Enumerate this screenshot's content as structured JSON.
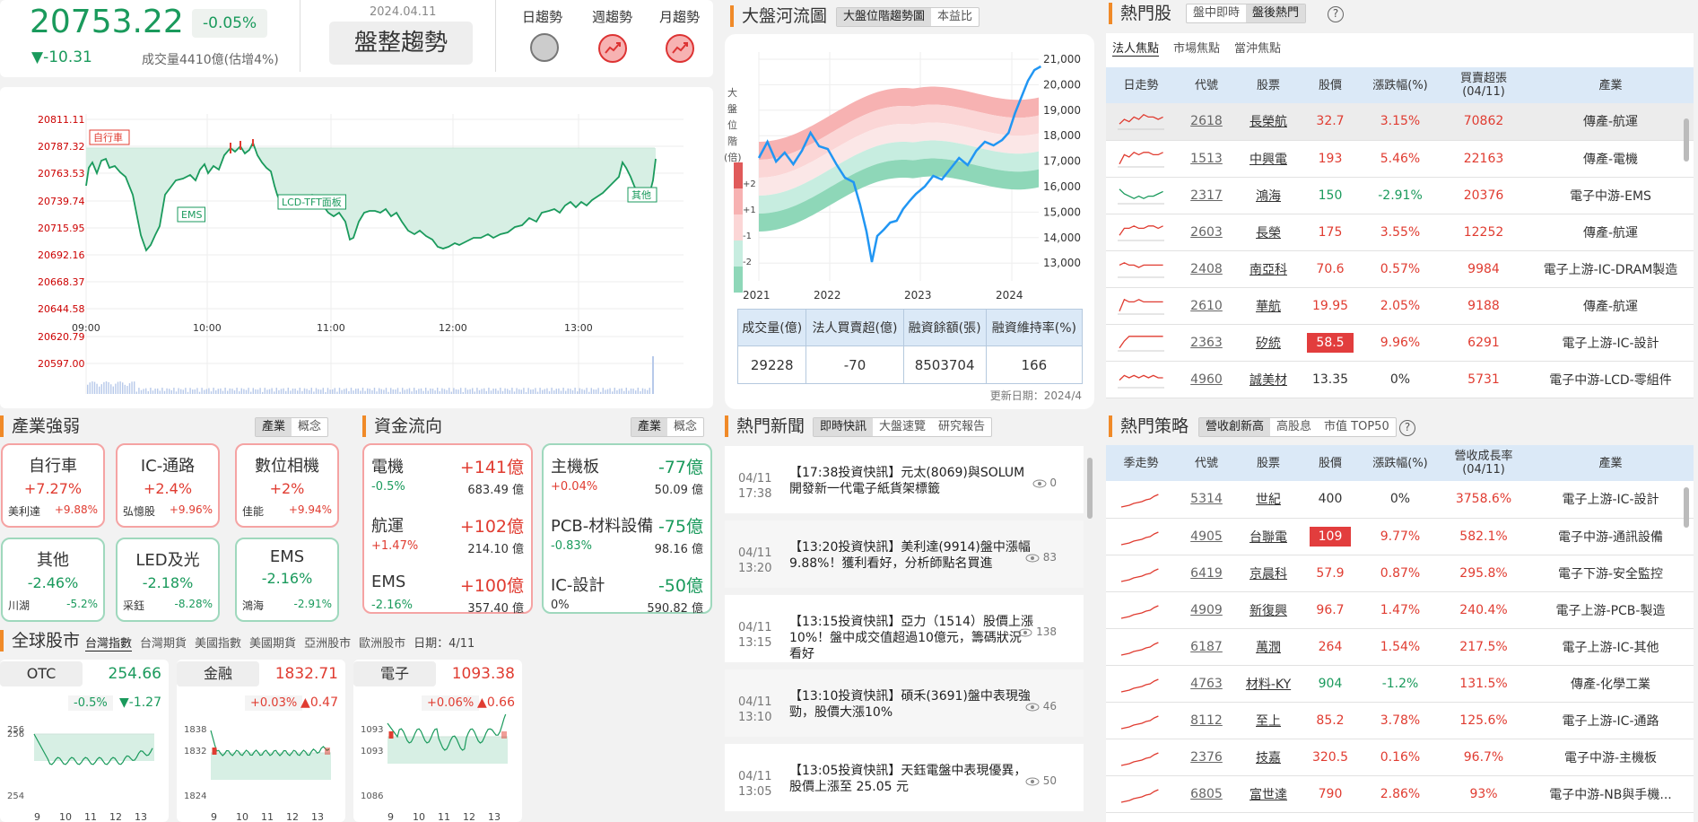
{
  "index": {
    "value": "20753.22",
    "change_pct": "-0.05%",
    "change": "▼-10.31",
    "volume": "成交量4410億(估增4%)",
    "date": "2024.04.11",
    "trend_label": "盤整趨勢",
    "trend_tabs": [
      "日趨勢",
      "週趨勢",
      "月趨勢"
    ]
  },
  "intraday": {
    "y_ticks": [
      "20811.11",
      "20787.32",
      "20763.53",
      "20739.74",
      "20715.95",
      "20692.16",
      "20668.37",
      "20644.58",
      "20620.79",
      "20597.00"
    ],
    "x_ticks": [
      "09:00",
      "10:00",
      "11:00",
      "12:00",
      "13:00"
    ],
    "annotations": [
      "自行車",
      "EMS",
      "LCD-TFT面板",
      "其他"
    ]
  },
  "river": {
    "title": "大盤河流圖",
    "tabs": [
      "大盤位階趨勢圖",
      "本益比"
    ],
    "ylabel_chars": [
      "大",
      "盤",
      "位",
      "階",
      "(倍)"
    ],
    "bands": [
      "+2",
      "+1",
      "-1",
      "-2"
    ],
    "y_ticks": [
      "21,000",
      "20,000",
      "19,000",
      "18,000",
      "17,000",
      "16,000",
      "15,000",
      "14,000",
      "13,000"
    ],
    "x_ticks": [
      "2021",
      "2022",
      "2023",
      "2024"
    ],
    "table_headers": [
      "成交量(億)",
      "法人買賣超(億)",
      "融資餘額(張)",
      "融資維持率(%)"
    ],
    "table_values": [
      "29228",
      "-70",
      "8503704",
      "166"
    ],
    "update": "更新日期：2024/4"
  },
  "hot_stocks": {
    "title": "熱門股",
    "tabs": [
      "盤中即時",
      "盤後熱門"
    ],
    "subtabs": [
      "法人焦點",
      "市場焦點",
      "當沖焦點"
    ],
    "headers": [
      "日走勢",
      "代號",
      "股票",
      "股價",
      "漲跌幅(%)",
      "買賣超張\n(04/11)",
      "產業"
    ],
    "rows": [
      {
        "code": "2618",
        "name": "長榮航",
        "price": "32.7",
        "pct": "3.15%",
        "vol": "70862",
        "ind": "傳產-航運",
        "dir": "up"
      },
      {
        "code": "1513",
        "name": "中興電",
        "price": "193",
        "pct": "5.46%",
        "vol": "22163",
        "ind": "傳產-電機",
        "dir": "up"
      },
      {
        "code": "2317",
        "name": "鴻海",
        "price": "150",
        "pct": "-2.91%",
        "vol": "20376",
        "ind": "電子中游-EMS",
        "dir": "dn"
      },
      {
        "code": "2603",
        "name": "長榮",
        "price": "175",
        "pct": "3.55%",
        "vol": "12252",
        "ind": "傳產-航運",
        "dir": "up"
      },
      {
        "code": "2408",
        "name": "南亞科",
        "price": "70.6",
        "pct": "0.57%",
        "vol": "9984",
        "ind": "電子上游-IC-DRAM製造",
        "dir": "up"
      },
      {
        "code": "2610",
        "name": "華航",
        "price": "19.95",
        "pct": "2.05%",
        "vol": "9188",
        "ind": "傳產-航運",
        "dir": "up"
      },
      {
        "code": "2363",
        "name": "矽統",
        "price": "58.5",
        "pct": "9.96%",
        "vol": "6291",
        "ind": "電子上游-IC-設計",
        "dir": "hl"
      },
      {
        "code": "4960",
        "name": "誠美材",
        "price": "13.35",
        "pct": "0%",
        "vol": "5731",
        "ind": "電子中游-LCD-零組件",
        "dir": "nt"
      }
    ]
  },
  "industry": {
    "title": "產業強弱",
    "tabs": [
      "產業",
      "概念"
    ],
    "boxes": [
      {
        "name": "自行車",
        "pct": "+7.27%",
        "stock": "美利達",
        "spct": "+9.88%",
        "dir": "up"
      },
      {
        "name": "IC-通路",
        "pct": "+2.4%",
        "stock": "弘憶股",
        "spct": "+9.96%",
        "dir": "up"
      },
      {
        "name": "數位相機",
        "pct": "+2%",
        "stock": "佳能",
        "spct": "+9.94%",
        "dir": "up"
      },
      {
        "name": "其他",
        "pct": "-2.46%",
        "stock": "川湖",
        "spct": "-5.2%",
        "dir": "dn"
      },
      {
        "name": "LED及光",
        "pct": "-2.18%",
        "stock": "采鈺",
        "spct": "-8.28%",
        "dir": "dn"
      },
      {
        "name": "EMS",
        "pct": "-2.16%",
        "stock": "鴻海",
        "spct": "-2.91%",
        "dir": "dn"
      }
    ]
  },
  "fund": {
    "title": "資金流向",
    "tabs": [
      "產業",
      "概念"
    ],
    "up": [
      {
        "name": "電機",
        "val": "+141億",
        "pct": "-0.5%",
        "amt": "683.49 億",
        "pdir": "dn"
      },
      {
        "name": "航運",
        "val": "+102億",
        "pct": "+1.47%",
        "amt": "214.10 億",
        "pdir": "up"
      },
      {
        "name": "EMS",
        "val": "+100億",
        "pct": "-2.16%",
        "amt": "357.40 億",
        "pdir": "dn"
      }
    ],
    "down": [
      {
        "name": "主機板",
        "val": "-77億",
        "pct": "+0.04%",
        "amt": "50.09 億",
        "pdir": "up"
      },
      {
        "name": "PCB-材料設備",
        "val": "-75億",
        "pct": "-0.83%",
        "amt": "98.16 億",
        "pdir": "dn"
      },
      {
        "name": "IC-設計",
        "val": "-50億",
        "pct": "0%",
        "amt": "590.82 億",
        "pdir": "nt"
      }
    ]
  },
  "global": {
    "title": "全球股市",
    "tabs": [
      "台灣指數",
      "台灣期貨",
      "美國指數",
      "美國期貨",
      "亞洲股市",
      "歐洲股市"
    ],
    "date": "日期：4/11",
    "cards": [
      {
        "name": "OTC",
        "val": "254.66",
        "pct": "-0.5%",
        "chg": "▼-1.27",
        "dir": "dn",
        "ticks": [
          "256",
          "256",
          "254"
        ]
      },
      {
        "name": "金融",
        "val": "1832.71",
        "pct": "+0.03%",
        "chg": "▲0.47",
        "dir": "up",
        "ticks": [
          "1838",
          "1832",
          "1824"
        ]
      },
      {
        "name": "電子",
        "val": "1093.38",
        "pct": "+0.06%",
        "chg": "▲0.66",
        "dir": "up",
        "ticks": [
          "1093",
          "1093",
          "1086"
        ]
      }
    ],
    "x_ticks": [
      "9",
      "10",
      "11",
      "12",
      "13"
    ]
  },
  "news": {
    "title": "熱門新聞",
    "tabs": [
      "即時快訊",
      "大盤速覽",
      "研究報告"
    ],
    "items": [
      {
        "date": "04/11",
        "time": "17:38",
        "title": "【17:38投資快訊】元太(8069)與SOLUM 開發新一代電子紙貨架標籤",
        "views": "0"
      },
      {
        "date": "04/11",
        "time": "13:20",
        "title": "【13:20投資快訊】美利達(9914)盤中漲幅9.88%！獲利看好，分析師點名買進",
        "views": "83"
      },
      {
        "date": "04/11",
        "time": "13:15",
        "title": "【13:15投資快訊】亞力（1514）股價上漲10%！盤中成交值超過10億元，籌碼狀況看好",
        "views": "138"
      },
      {
        "date": "04/11",
        "time": "13:10",
        "title": "【13:10投資快訊】碩禾(3691)盤中表現強勁，股價大漲10%",
        "views": "46"
      },
      {
        "date": "04/11",
        "time": "13:05",
        "title": "【13:05投資快訊】天鈺電盤中表現優異，股價上漲至 25.05 元",
        "views": "50"
      }
    ]
  },
  "strategy": {
    "title": "熱門策略",
    "tabs": [
      "營收創新高",
      "高股息",
      "市值 TOP50"
    ],
    "headers": [
      "季走勢",
      "代號",
      "股票",
      "股價",
      "漲跌幅(%)",
      "營收成長率\n(04/11)",
      "產業"
    ],
    "rows": [
      {
        "code": "5314",
        "name": "世紀",
        "price": "400",
        "pct": "0%",
        "rate": "3758.6%",
        "ind": "電子上游-IC-設計",
        "dir": "nt"
      },
      {
        "code": "4905",
        "name": "台聯電",
        "price": "109",
        "pct": "9.77%",
        "rate": "582.1%",
        "ind": "電子中游-通訊設備",
        "dir": "hl"
      },
      {
        "code": "6419",
        "name": "京晨科",
        "price": "57.9",
        "pct": "0.87%",
        "rate": "295.8%",
        "ind": "電子下游-安全監控",
        "dir": "up"
      },
      {
        "code": "4909",
        "name": "新復興",
        "price": "96.7",
        "pct": "1.47%",
        "rate": "240.4%",
        "ind": "電子上游-PCB-製造",
        "dir": "up"
      },
      {
        "code": "6187",
        "name": "萬潤",
        "price": "264",
        "pct": "1.54%",
        "rate": "217.5%",
        "ind": "電子上游-IC-其他",
        "dir": "up"
      },
      {
        "code": "4763",
        "name": "材料-KY",
        "price": "904",
        "pct": "-1.2%",
        "rate": "131.5%",
        "ind": "傳產-化學工業",
        "dir": "dn"
      },
      {
        "code": "8112",
        "name": "至上",
        "price": "85.2",
        "pct": "3.78%",
        "rate": "125.6%",
        "ind": "電子上游-IC-通路",
        "dir": "up"
      },
      {
        "code": "2376",
        "name": "技嘉",
        "price": "320.5",
        "pct": "0.16%",
        "rate": "96.7%",
        "ind": "電子中游-主機板",
        "dir": "up"
      },
      {
        "code": "6805",
        "name": "富世達",
        "price": "790",
        "pct": "2.86%",
        "rate": "93%",
        "ind": "電子中游-NB與手機...",
        "dir": "up"
      }
    ]
  }
}
